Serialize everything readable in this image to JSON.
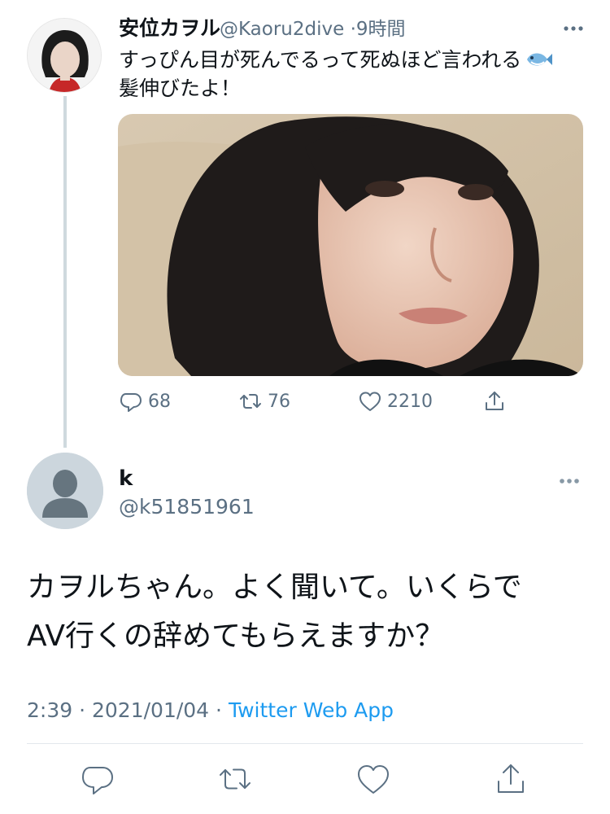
{
  "original_tweet": {
    "author_name": "安位カヲル",
    "handle": "@Kaoru2dive",
    "separator": "·",
    "time": "9時間",
    "text_line1": "すっぴん目が死んでるって死ぬほど言われる",
    "emoji_icon": "fish-emoji-icon",
    "text_line2": "髪伸びたよ！",
    "replies": "68",
    "retweets": "76",
    "likes": "2210"
  },
  "reply_tweet": {
    "author_name": "k",
    "handle": "@k51851961",
    "text_line1": "カヲルちゃん。よく聞いて。いくらで",
    "text_line2": "AV行くの辞めてもらえますか？",
    "time": "2:39",
    "separator1": "·",
    "date": "2021/01/04",
    "separator2": "·",
    "source": "Twitter Web App"
  },
  "colors": {
    "text": "#0f1419",
    "secondary": "#5b7083",
    "link": "#1d9bf0",
    "thread_line": "#cfd9de"
  }
}
